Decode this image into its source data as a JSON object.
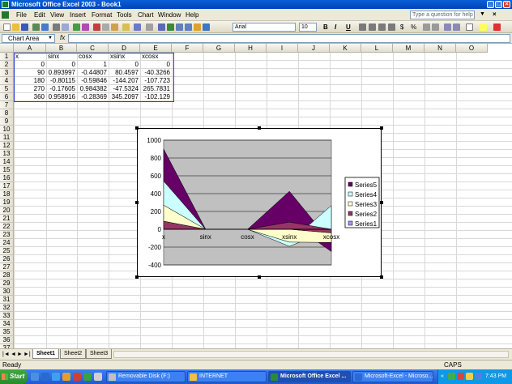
{
  "window": {
    "title": "Microsoft Office Excel 2003 - Book1"
  },
  "menu": {
    "items": [
      "File",
      "Edit",
      "View",
      "Insert",
      "Format",
      "Tools",
      "Chart",
      "Window",
      "Help"
    ],
    "help_placeholder": "Type a question for help"
  },
  "toolbar": {
    "font_name": "Arial",
    "font_size": "10",
    "bold_label": "B",
    "italic_label": "I",
    "underline_label": "U",
    "currency_label": "$",
    "percent_label": "%"
  },
  "formula_bar": {
    "name_box": "Chart Area",
    "fx_label": "fx",
    "formula_value": ""
  },
  "columns": [
    "A",
    "B",
    "C",
    "D",
    "E",
    "F",
    "G",
    "H",
    "I",
    "J",
    "K",
    "L",
    "M",
    "N",
    "O"
  ],
  "rows": [
    "1",
    "2",
    "3",
    "4",
    "5",
    "6",
    "7",
    "8",
    "9",
    "10",
    "11",
    "12",
    "13",
    "14",
    "15",
    "16",
    "17",
    "18",
    "19",
    "20",
    "21",
    "22",
    "23",
    "24",
    "25",
    "26",
    "27",
    "28",
    "29",
    "30",
    "31",
    "32",
    "33",
    "34",
    "35",
    "36",
    "37"
  ],
  "cells": [
    [
      "x",
      "sinx",
      "cosx",
      "xsinx",
      "xcosx"
    ],
    [
      "0",
      "0",
      "1",
      "0",
      "0"
    ],
    [
      "90",
      "0.893997",
      "-0.44807",
      "80.4597",
      "-40.3266"
    ],
    [
      "180",
      "-0.80115",
      "-0.59846",
      "-144.207",
      "-107.723"
    ],
    [
      "270",
      "-0.17605",
      "0.984382",
      "-47.5324",
      "265.7831"
    ],
    [
      "360",
      "0.958916",
      "-0.28369",
      "345.2097",
      "-102.129"
    ]
  ],
  "chart_data": {
    "type": "area",
    "stacked": true,
    "categories": [
      "x",
      "sinx",
      "cosx",
      "xsinx",
      "xcosx"
    ],
    "series": [
      {
        "name": "Series1",
        "values": [
          0,
          0,
          1,
          0,
          0
        ],
        "color": "#9999ff"
      },
      {
        "name": "Series2",
        "values": [
          90,
          0.893997,
          -0.44807,
          80.4597,
          -40.3266
        ],
        "color": "#993366"
      },
      {
        "name": "Series3",
        "values": [
          180,
          -0.80115,
          -0.59846,
          -144.207,
          -107.723
        ],
        "color": "#ffffcc"
      },
      {
        "name": "Series4",
        "values": [
          270,
          -0.17605,
          0.984382,
          -47.5324,
          265.7831
        ],
        "color": "#ccffff"
      },
      {
        "name": "Series5",
        "values": [
          360,
          0.958916,
          -0.28369,
          345.2097,
          -102.129
        ],
        "color": "#660066"
      }
    ],
    "ylim": [
      -400,
      1000
    ],
    "yticks": [
      "1000",
      "800",
      "600",
      "400",
      "200",
      "0",
      "-200",
      "-400"
    ],
    "plot_bg": "#c0c0c0",
    "grid": true,
    "legend_position": "right"
  },
  "sheet_tabs": [
    "Sheet1",
    "Sheet2",
    "Sheet3"
  ],
  "status": {
    "left": "Ready",
    "caps": "CAPS"
  },
  "taskbar": {
    "start_label": "Start",
    "tasks": [
      "Removable Disk (F:)",
      "INTERNET",
      "Microsoft Office Excel ...",
      "Microsoft-Excel - Microso..."
    ],
    "clock": "7:43 PM"
  }
}
